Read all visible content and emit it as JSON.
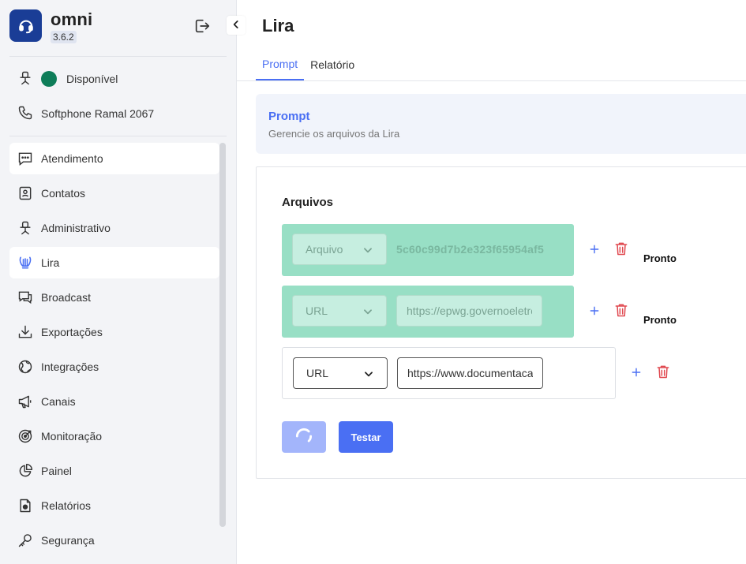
{
  "app": {
    "name": "omni",
    "version": "3.6.2"
  },
  "status": {
    "label": "Disponível",
    "color": "#0e7d59"
  },
  "softphone": {
    "label": "Softphone Ramal 2067"
  },
  "nav": [
    {
      "label": "Atendimento",
      "icon": "chat-dots-icon"
    },
    {
      "label": "Contatos",
      "icon": "contact-card-icon"
    },
    {
      "label": "Administrativo",
      "icon": "headset-desk-icon"
    },
    {
      "label": "Lira",
      "icon": "lyre-icon",
      "active": true
    },
    {
      "label": "Broadcast",
      "icon": "chat-bubbles-icon"
    },
    {
      "label": "Exportações",
      "icon": "download-icon"
    },
    {
      "label": "Integrações",
      "icon": "globe-icon"
    },
    {
      "label": "Canais",
      "icon": "megaphone-icon"
    },
    {
      "label": "Monitoração",
      "icon": "target-icon"
    },
    {
      "label": "Painel",
      "icon": "pie-chart-icon"
    },
    {
      "label": "Relatórios",
      "icon": "report-file-icon"
    },
    {
      "label": "Segurança",
      "icon": "key-icon"
    }
  ],
  "page": {
    "title": "Lira",
    "tabs": [
      {
        "label": "Prompt",
        "active": true
      },
      {
        "label": "Relatório",
        "active": false
      }
    ],
    "header": {
      "title": "Prompt",
      "subtitle": "Gerencie os arquivos da Lira"
    },
    "files": {
      "title": "Arquivos",
      "rows": [
        {
          "type": "Arquivo",
          "value": "5c60c99d7b2e323f65954af5",
          "status": "Pronto"
        },
        {
          "type": "URL",
          "value": "https://epwg.governoeletronico.gov.br",
          "status": "Pronto"
        },
        {
          "type": "URL",
          "value": "https://www.documentacao",
          "status": ""
        }
      ]
    },
    "test_button": "Testar"
  },
  "colors": {
    "accent": "#4a6ff3",
    "done_row": "#98dfc5",
    "delete": "#e0484f",
    "brand": "#1a3d96"
  }
}
